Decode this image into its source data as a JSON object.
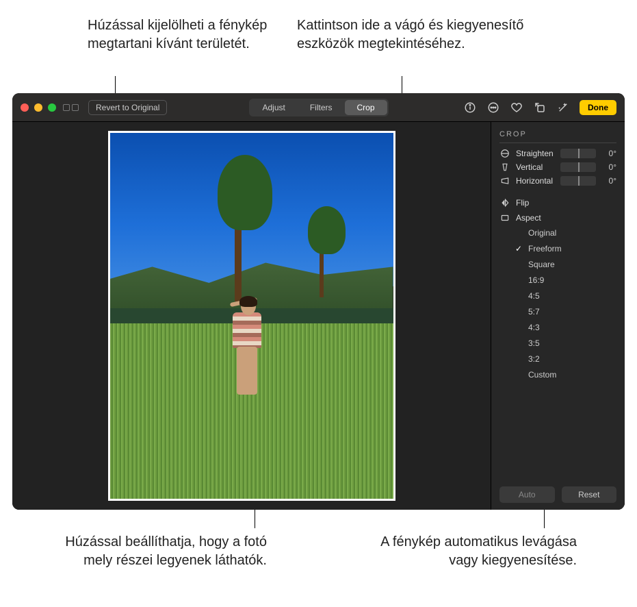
{
  "callouts": {
    "top_left": "Húzással kijelölheti a fénykép megtartani kívánt területét.",
    "top_right": "Kattintson ide a vágó és kiegyenesítő eszközök megtekintéséhez.",
    "bottom_left": "Húzással beállíthatja, hogy a fotó mely részei legyenek láthatók.",
    "bottom_right": "A fénykép automatikus levágása vagy kiegyenesítése."
  },
  "toolbar": {
    "revert": "Revert to Original",
    "tabs": {
      "adjust": "Adjust",
      "filters": "Filters",
      "crop": "Crop"
    },
    "done": "Done"
  },
  "panel": {
    "title": "CROP",
    "sliders": {
      "straighten": {
        "label": "Straighten",
        "value": "0°"
      },
      "vertical": {
        "label": "Vertical",
        "value": "0°"
      },
      "horizontal": {
        "label": "Horizontal",
        "value": "0°"
      }
    },
    "flip": "Flip",
    "aspect": "Aspect",
    "aspect_options": {
      "original": "Original",
      "freeform": "Freeform",
      "square": "Square",
      "r16_9": "16:9",
      "r4_5": "4:5",
      "r5_7": "5:7",
      "r4_3": "4:3",
      "r3_5": "3:5",
      "r3_2": "3:2",
      "custom": "Custom"
    },
    "selected_aspect": "freeform",
    "auto": "Auto",
    "reset": "Reset"
  }
}
